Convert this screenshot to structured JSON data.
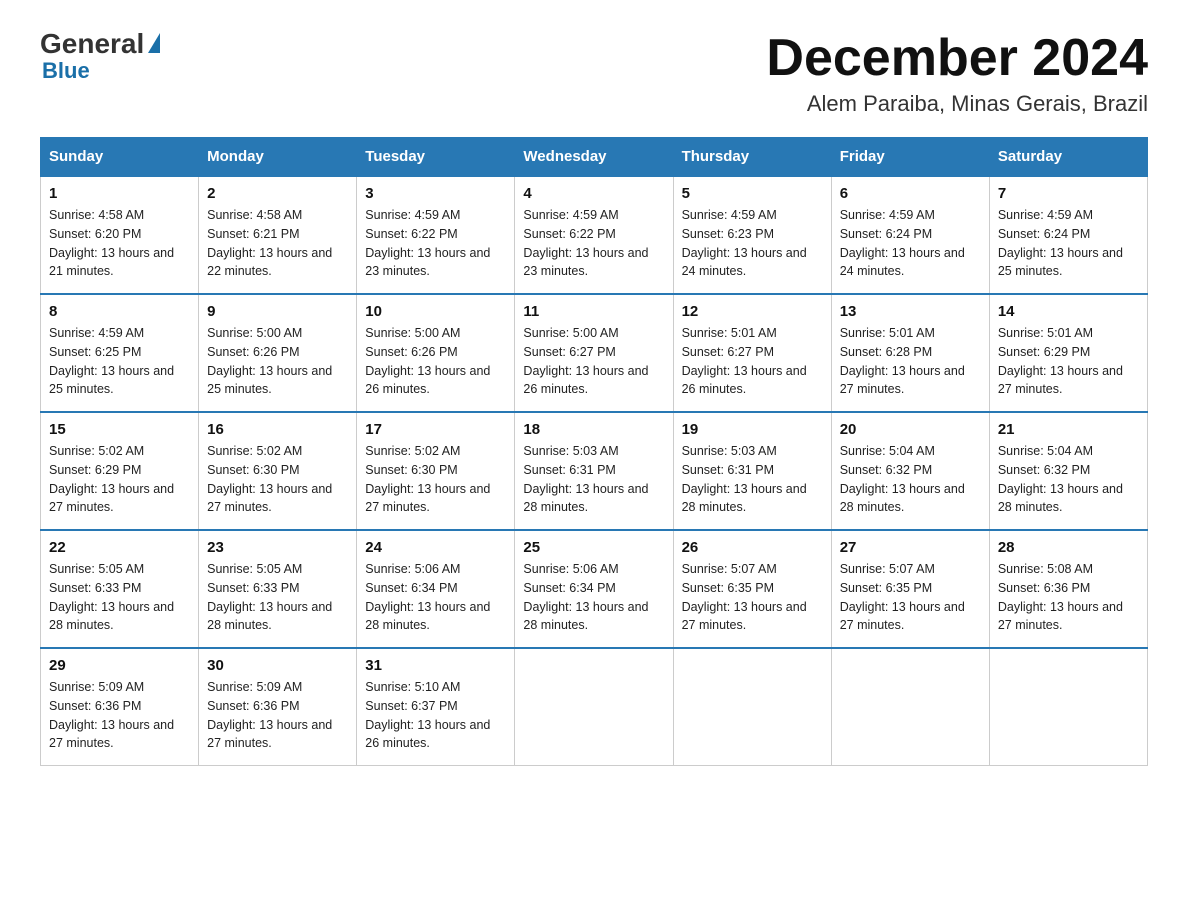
{
  "header": {
    "logo_general": "General",
    "logo_blue": "Blue",
    "month_title": "December 2024",
    "location": "Alem Paraiba, Minas Gerais, Brazil"
  },
  "weekdays": [
    "Sunday",
    "Monday",
    "Tuesday",
    "Wednesday",
    "Thursday",
    "Friday",
    "Saturday"
  ],
  "weeks": [
    [
      {
        "day": "1",
        "sunrise": "4:58 AM",
        "sunset": "6:20 PM",
        "daylight": "13 hours and 21 minutes."
      },
      {
        "day": "2",
        "sunrise": "4:58 AM",
        "sunset": "6:21 PM",
        "daylight": "13 hours and 22 minutes."
      },
      {
        "day": "3",
        "sunrise": "4:59 AM",
        "sunset": "6:22 PM",
        "daylight": "13 hours and 23 minutes."
      },
      {
        "day": "4",
        "sunrise": "4:59 AM",
        "sunset": "6:22 PM",
        "daylight": "13 hours and 23 minutes."
      },
      {
        "day": "5",
        "sunrise": "4:59 AM",
        "sunset": "6:23 PM",
        "daylight": "13 hours and 24 minutes."
      },
      {
        "day": "6",
        "sunrise": "4:59 AM",
        "sunset": "6:24 PM",
        "daylight": "13 hours and 24 minutes."
      },
      {
        "day": "7",
        "sunrise": "4:59 AM",
        "sunset": "6:24 PM",
        "daylight": "13 hours and 25 minutes."
      }
    ],
    [
      {
        "day": "8",
        "sunrise": "4:59 AM",
        "sunset": "6:25 PM",
        "daylight": "13 hours and 25 minutes."
      },
      {
        "day": "9",
        "sunrise": "5:00 AM",
        "sunset": "6:26 PM",
        "daylight": "13 hours and 25 minutes."
      },
      {
        "day": "10",
        "sunrise": "5:00 AM",
        "sunset": "6:26 PM",
        "daylight": "13 hours and 26 minutes."
      },
      {
        "day": "11",
        "sunrise": "5:00 AM",
        "sunset": "6:27 PM",
        "daylight": "13 hours and 26 minutes."
      },
      {
        "day": "12",
        "sunrise": "5:01 AM",
        "sunset": "6:27 PM",
        "daylight": "13 hours and 26 minutes."
      },
      {
        "day": "13",
        "sunrise": "5:01 AM",
        "sunset": "6:28 PM",
        "daylight": "13 hours and 27 minutes."
      },
      {
        "day": "14",
        "sunrise": "5:01 AM",
        "sunset": "6:29 PM",
        "daylight": "13 hours and 27 minutes."
      }
    ],
    [
      {
        "day": "15",
        "sunrise": "5:02 AM",
        "sunset": "6:29 PM",
        "daylight": "13 hours and 27 minutes."
      },
      {
        "day": "16",
        "sunrise": "5:02 AM",
        "sunset": "6:30 PM",
        "daylight": "13 hours and 27 minutes."
      },
      {
        "day": "17",
        "sunrise": "5:02 AM",
        "sunset": "6:30 PM",
        "daylight": "13 hours and 27 minutes."
      },
      {
        "day": "18",
        "sunrise": "5:03 AM",
        "sunset": "6:31 PM",
        "daylight": "13 hours and 28 minutes."
      },
      {
        "day": "19",
        "sunrise": "5:03 AM",
        "sunset": "6:31 PM",
        "daylight": "13 hours and 28 minutes."
      },
      {
        "day": "20",
        "sunrise": "5:04 AM",
        "sunset": "6:32 PM",
        "daylight": "13 hours and 28 minutes."
      },
      {
        "day": "21",
        "sunrise": "5:04 AM",
        "sunset": "6:32 PM",
        "daylight": "13 hours and 28 minutes."
      }
    ],
    [
      {
        "day": "22",
        "sunrise": "5:05 AM",
        "sunset": "6:33 PM",
        "daylight": "13 hours and 28 minutes."
      },
      {
        "day": "23",
        "sunrise": "5:05 AM",
        "sunset": "6:33 PM",
        "daylight": "13 hours and 28 minutes."
      },
      {
        "day": "24",
        "sunrise": "5:06 AM",
        "sunset": "6:34 PM",
        "daylight": "13 hours and 28 minutes."
      },
      {
        "day": "25",
        "sunrise": "5:06 AM",
        "sunset": "6:34 PM",
        "daylight": "13 hours and 28 minutes."
      },
      {
        "day": "26",
        "sunrise": "5:07 AM",
        "sunset": "6:35 PM",
        "daylight": "13 hours and 27 minutes."
      },
      {
        "day": "27",
        "sunrise": "5:07 AM",
        "sunset": "6:35 PM",
        "daylight": "13 hours and 27 minutes."
      },
      {
        "day": "28",
        "sunrise": "5:08 AM",
        "sunset": "6:36 PM",
        "daylight": "13 hours and 27 minutes."
      }
    ],
    [
      {
        "day": "29",
        "sunrise": "5:09 AM",
        "sunset": "6:36 PM",
        "daylight": "13 hours and 27 minutes."
      },
      {
        "day": "30",
        "sunrise": "5:09 AM",
        "sunset": "6:36 PM",
        "daylight": "13 hours and 27 minutes."
      },
      {
        "day": "31",
        "sunrise": "5:10 AM",
        "sunset": "6:37 PM",
        "daylight": "13 hours and 26 minutes."
      },
      null,
      null,
      null,
      null
    ]
  ]
}
